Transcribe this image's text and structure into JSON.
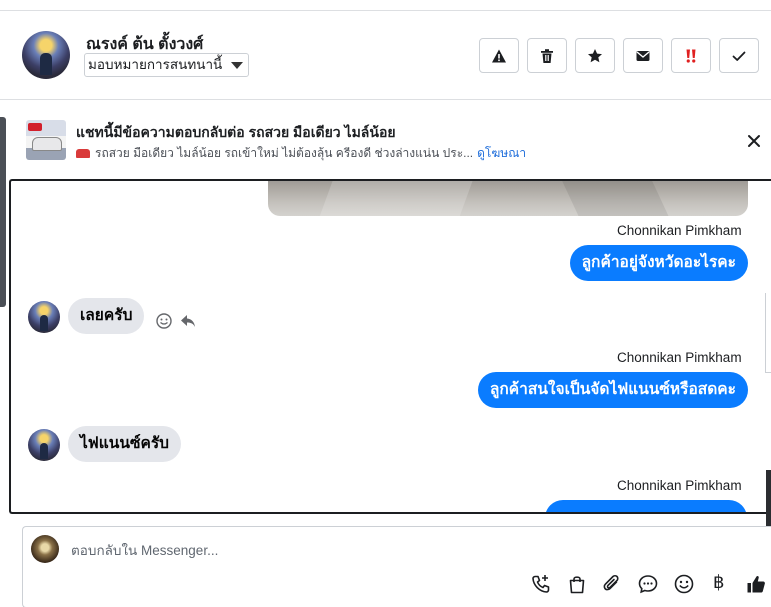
{
  "header": {
    "contact_name": "ณรงค์ ต้น ตั้งวงศ์",
    "assign_label": "มอบหมายการสนทนานี้",
    "toolbar": [
      {
        "name": "report-spam-button",
        "icon": "warning-triangle-icon"
      },
      {
        "name": "delete-button",
        "icon": "trash-icon"
      },
      {
        "name": "star-button",
        "icon": "star-icon"
      },
      {
        "name": "mark-unread-button",
        "icon": "envelope-icon"
      },
      {
        "name": "follow-up-button",
        "icon": "double-exclamation-icon"
      },
      {
        "name": "mark-done-button",
        "icon": "checkmark-icon"
      }
    ]
  },
  "ad_banner": {
    "title": "แชทนี้มีข้อความตอบกลับต่อ รถสวย มือเดียว ไมล์น้อย",
    "subtitle": "รถสวย มือเดียว ไมล์น้อย รถเข้าใหม่ ไม่ต้องลุ้น ครีองดี ช่วงล่างแน่น ประ...",
    "link": "ดูโฆษณา",
    "close_icon": "close-icon"
  },
  "conversation": {
    "messages": [
      {
        "sender": "Chonnikan Pimkham",
        "direction": "outgoing",
        "text": "ลูกค้าอยู่จังหวัดอะไรคะ"
      },
      {
        "direction": "incoming",
        "text": "เลยครับ"
      },
      {
        "sender": "Chonnikan Pimkham",
        "direction": "outgoing",
        "text": "ลูกค้าสนใจเป็นจัดไฟแนนซ์หรือสดคะ"
      },
      {
        "direction": "incoming",
        "text": "ไฟแนนซ์ครับ"
      },
      {
        "sender": "Chonnikan Pimkham",
        "direction": "outgoing",
        "text": ""
      }
    ]
  },
  "composer": {
    "placeholder": "ตอบกลับใน Messenger...",
    "value": "",
    "icons": [
      "phone-plus-icon",
      "shopping-bag-icon",
      "paperclip-icon",
      "saved-reply-icon",
      "emoji-icon",
      "baht-icon",
      "thumbs-up-icon"
    ],
    "baht_symbol": "฿"
  },
  "colors": {
    "outgoing_bubble": "#0a7cff",
    "incoming_bubble": "#e4e6eb",
    "link": "#216fdb",
    "follow_up_icon": "#e02020"
  }
}
